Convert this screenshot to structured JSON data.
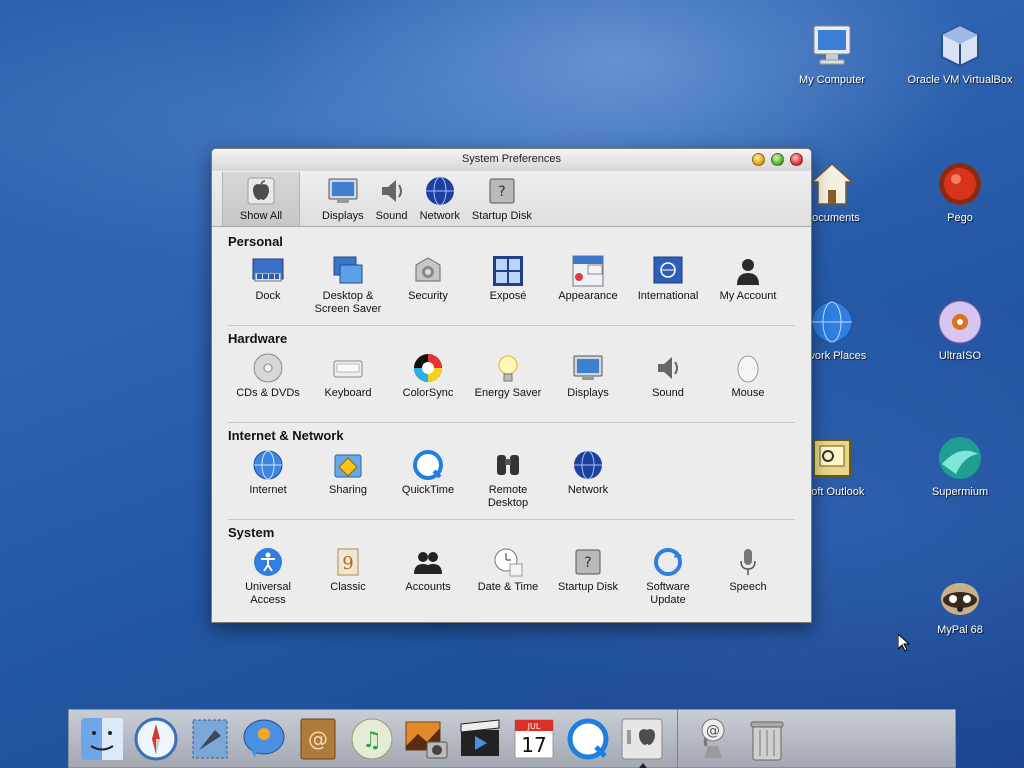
{
  "desktop": {
    "icons": [
      {
        "label": "My Computer",
        "icon": "computer-icon"
      },
      {
        "label": "Oracle VM VirtualBox",
        "icon": "virtualbox-icon"
      },
      {
        "label": "Documents",
        "icon": "house-icon"
      },
      {
        "label": "Pego",
        "icon": "pego-icon"
      },
      {
        "label": "etwork Places",
        "icon": "globe-icon"
      },
      {
        "label": "UltraISO",
        "icon": "disc-icon"
      },
      {
        "label": "osoft Outlook",
        "icon": "outlook-icon"
      },
      {
        "label": "Supermium",
        "icon": "supermium-icon"
      },
      {
        "label": "MyPal 68",
        "icon": "raccoon-icon"
      }
    ]
  },
  "window": {
    "title": "System Preferences",
    "toolbar": [
      {
        "label": "Show All",
        "icon": "apple-icon"
      },
      {
        "label": "Displays",
        "icon": "display-icon"
      },
      {
        "label": "Sound",
        "icon": "speaker-icon"
      },
      {
        "label": "Network",
        "icon": "globe-icon"
      },
      {
        "label": "Startup Disk",
        "icon": "harddisk-icon"
      }
    ],
    "sections": [
      {
        "title": "Personal",
        "panes": [
          {
            "label": "Dock",
            "icon": "dock-icon"
          },
          {
            "label": "Desktop & Screen Saver",
            "icon": "desktop-icon"
          },
          {
            "label": "Security",
            "icon": "security-icon"
          },
          {
            "label": "Exposé",
            "icon": "expose-icon"
          },
          {
            "label": "Appearance",
            "icon": "appearance-icon"
          },
          {
            "label": "International",
            "icon": "flag-icon"
          },
          {
            "label": "My Account",
            "icon": "user-icon"
          }
        ]
      },
      {
        "title": "Hardware",
        "panes": [
          {
            "label": "CDs & DVDs",
            "icon": "cd-icon"
          },
          {
            "label": "Keyboard",
            "icon": "keyboard-icon"
          },
          {
            "label": "ColorSync",
            "icon": "colorsync-icon"
          },
          {
            "label": "Energy Saver",
            "icon": "bulb-icon"
          },
          {
            "label": "Displays",
            "icon": "display-icon"
          },
          {
            "label": "Sound",
            "icon": "speaker-icon"
          },
          {
            "label": "Mouse",
            "icon": "mouse-icon"
          }
        ]
      },
      {
        "title": "Internet & Network",
        "panes": [
          {
            "label": "Internet",
            "icon": "globe-icon"
          },
          {
            "label": "Sharing",
            "icon": "sharing-icon"
          },
          {
            "label": "QuickTime",
            "icon": "quicktime-icon"
          },
          {
            "label": "Remote Desktop",
            "icon": "binoculars-icon"
          },
          {
            "label": "Network",
            "icon": "network-globe-icon"
          }
        ]
      },
      {
        "title": "System",
        "panes": [
          {
            "label": "Universal Access",
            "icon": "accessibility-icon"
          },
          {
            "label": "Classic",
            "icon": "classic-icon"
          },
          {
            "label": "Accounts",
            "icon": "accounts-icon"
          },
          {
            "label": "Date & Time",
            "icon": "clock-icon"
          },
          {
            "label": "Startup Disk",
            "icon": "harddisk-icon"
          },
          {
            "label": "Software Update",
            "icon": "update-icon"
          },
          {
            "label": "Speech",
            "icon": "microphone-icon"
          }
        ]
      }
    ]
  },
  "dock": {
    "apps": [
      "finder-icon",
      "safari-icon",
      "mail-icon",
      "ichat-icon",
      "address-book-icon",
      "itunes-icon",
      "iphoto-icon",
      "imovie-icon",
      "ical-icon",
      "quicktime-icon",
      "system-preferences-icon"
    ],
    "calendar": {
      "month": "JUL",
      "day": "17"
    },
    "trailing": [
      "mail-at-icon",
      "trash-icon"
    ]
  }
}
